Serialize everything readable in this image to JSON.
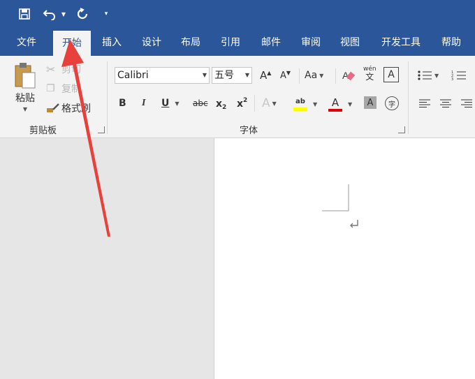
{
  "quick_access": {
    "save_icon": "save-icon",
    "undo_icon": "undo-icon",
    "redo_icon": "redo-icon",
    "customize_icon": "customize-icon"
  },
  "tabs": [
    {
      "label": "文件"
    },
    {
      "label": "开始"
    },
    {
      "label": "插入"
    },
    {
      "label": "设计"
    },
    {
      "label": "布局"
    },
    {
      "label": "引用"
    },
    {
      "label": "邮件"
    },
    {
      "label": "审阅"
    },
    {
      "label": "视图"
    },
    {
      "label": "开发工具"
    },
    {
      "label": "帮助"
    }
  ],
  "clipboard": {
    "paste_label": "粘贴",
    "cut_label": "剪切",
    "copy_label": "复制",
    "format_painter_label": "格式刷",
    "group_label": "剪贴板"
  },
  "font": {
    "font_name": "Calibri",
    "font_size": "五号",
    "group_label": "字体",
    "bold": "B",
    "italic": "I",
    "underline": "U",
    "strike": "abc",
    "subscript": "x",
    "superscript": "x",
    "sub_mark": "2",
    "sup_mark": "2",
    "grow": "A",
    "shrink": "A",
    "case": "Aa",
    "phonetic_top": "wén",
    "phonetic_bottom": "文",
    "border_char": "A",
    "effects": "A",
    "highlight": "ab",
    "font_color": "A",
    "shading": "A",
    "enclose": "字"
  },
  "colors": {
    "brand": "#2b579a",
    "highlight": "#ffff00",
    "font_color": "#e00000",
    "arrow": "#e8403a"
  }
}
